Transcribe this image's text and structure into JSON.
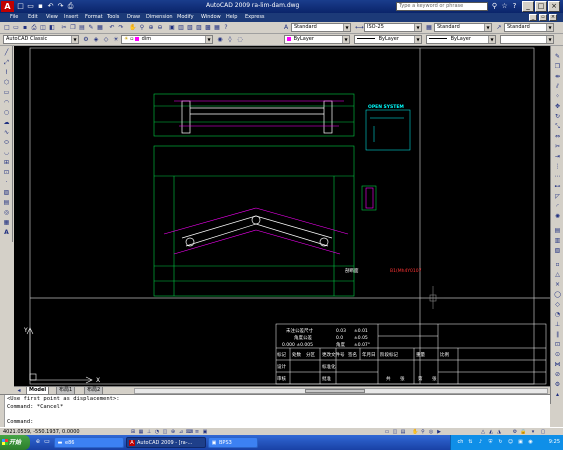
{
  "window": {
    "title": "AutoCAD 2009  ra-lim-dam.dwg",
    "search_placeholder": "Type a keyword or phrase"
  },
  "menu": [
    "File",
    "Edit",
    "View",
    "Insert",
    "Format",
    "Tools",
    "Draw",
    "Dimension",
    "Modify",
    "Window",
    "Help",
    "Express"
  ],
  "toolbar1": {
    "text_style": "Standard",
    "dim_style": "ISO-25",
    "table_style": "Standard",
    "multileader_style": "Standard"
  },
  "toolbar2": {
    "workspace": "AutoCAD Classic",
    "layer": "dim",
    "color": "ByLayer",
    "linetype": "ByLayer",
    "lineweight": "ByLayer"
  },
  "drawing": {
    "open_system_label": "OPEN SYSTEM",
    "section_label": "剖断面",
    "drawing_number": "B1(Mh4Y0107"
  },
  "title_block": {
    "tolerances": [
      [
        "未注公差尺寸",
        "0.03",
        "±0.01"
      ],
      [
        "角度公差",
        "0.0",
        "±0.05"
      ],
      [
        "0.000 ±0.005",
        "角度",
        "±0.07°"
      ]
    ],
    "change_header": [
      "标记",
      "处数",
      "分区",
      "更改文件号",
      "签名",
      "年月日"
    ],
    "rows_left": [
      "设计",
      "审核",
      "工艺"
    ],
    "standardized": "标准化",
    "approved": "批准",
    "stage_label": "阶段标记",
    "weight_label": "重量",
    "scale_label": "比例",
    "sheet_info": [
      "共",
      "张",
      "第",
      "张"
    ]
  },
  "layout_tabs": [
    "Model",
    "布局1",
    "布局2"
  ],
  "command": {
    "lines": [
      "<Use first point as displacement>:",
      "Command: *Cancel*",
      "",
      "Command:"
    ]
  },
  "status": {
    "coords": "4021.0539, -550.1937, 0.0000"
  },
  "taskbar": {
    "start_label": "开始",
    "tasks": [
      {
        "label": "e86",
        "active": false
      },
      {
        "label": "AutoCAD 2009 - [ra-...",
        "active": true
      },
      {
        "label": "BPS3",
        "active": false
      }
    ],
    "clock": "9:25"
  }
}
